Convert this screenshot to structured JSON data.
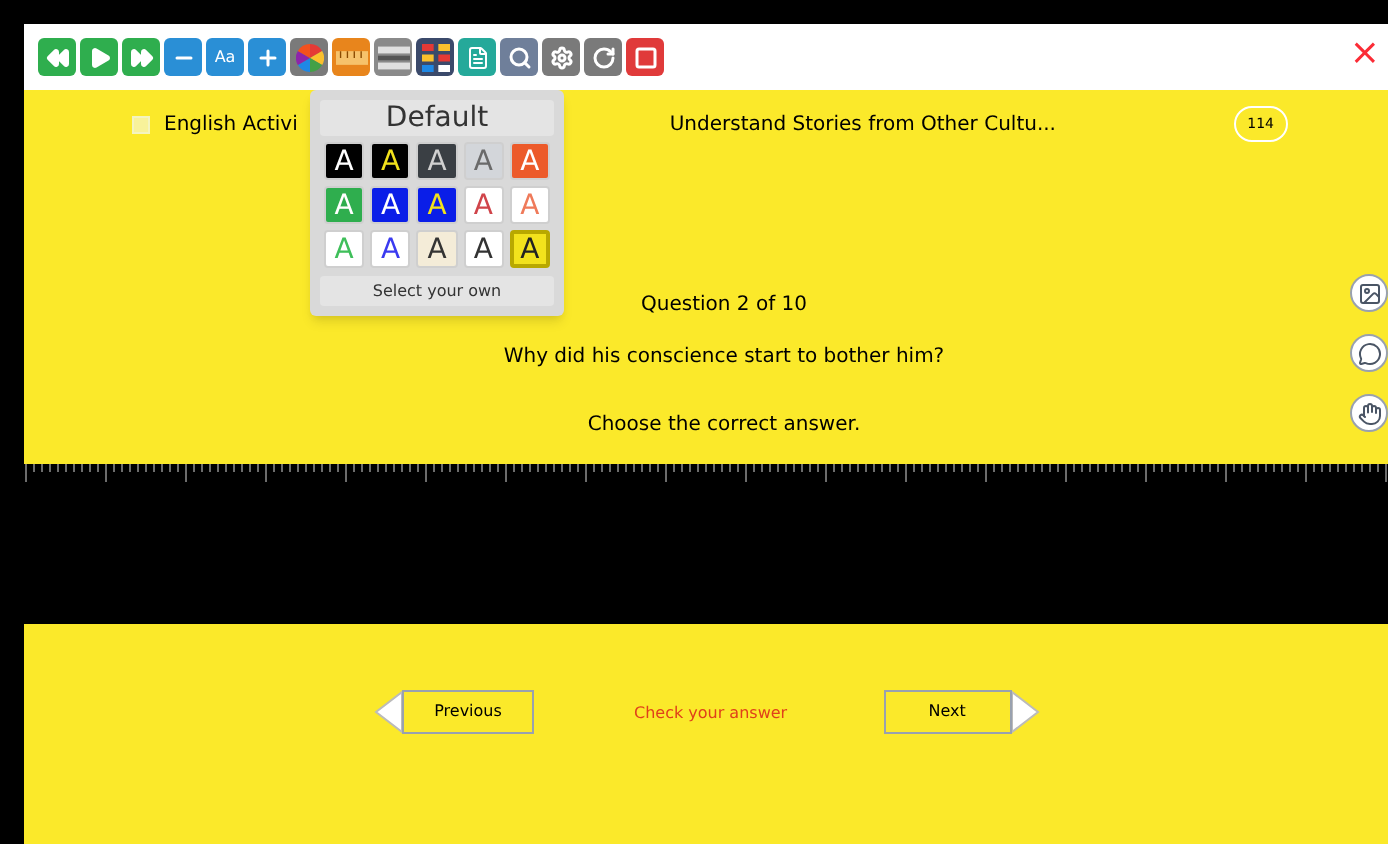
{
  "toolbar": {
    "buttons": [
      {
        "kind": "rewind",
        "color": "#2fae4e"
      },
      {
        "kind": "play",
        "color": "#2fae4e"
      },
      {
        "kind": "forward",
        "color": "#2fae4e"
      },
      {
        "kind": "minus",
        "color": "#2a8fd6"
      },
      {
        "kind": "text",
        "color": "#2a8fd6",
        "label": "Aa"
      },
      {
        "kind": "plus",
        "color": "#2a8fd6"
      },
      {
        "kind": "colors",
        "color": "#7a7a7a"
      },
      {
        "kind": "ruler",
        "color": "#e8851c"
      },
      {
        "kind": "mask",
        "color": "#8a8a8a"
      },
      {
        "kind": "grid",
        "color": "#3b4a6b"
      },
      {
        "kind": "notes",
        "color": "#25a99a"
      },
      {
        "kind": "search",
        "color": "#6f7f9a"
      },
      {
        "kind": "settings",
        "color": "#7a7a7a"
      },
      {
        "kind": "reload",
        "color": "#7a7a7a"
      },
      {
        "kind": "stop",
        "color": "#e03a3a"
      }
    ],
    "close": "×"
  },
  "header": {
    "checked": false,
    "title_left": "English Activi",
    "title_right": "Understand Stories from Other Cultu...",
    "badge": "114"
  },
  "color_popup": {
    "title": "Default",
    "swatches": [
      {
        "color": "#000000",
        "letter": {
          "label": "A",
          "color": "#ffffff"
        },
        "selected": false
      },
      {
        "color": "#000000",
        "letter": {
          "label": "A",
          "color": "#f2e21c"
        },
        "selected": false
      },
      {
        "color": "#3a3f44",
        "letter": {
          "label": "A",
          "color": "#d0d0d0"
        },
        "selected": false
      },
      {
        "color": "#d3d6da",
        "letter": {
          "label": "A",
          "color": "#6a6a6a"
        },
        "selected": false
      },
      {
        "color": "#ec5a2a",
        "letter": {
          "label": "A",
          "color": "#ffffff"
        },
        "selected": false
      },
      {
        "color": "#2fae4e",
        "letter": {
          "label": "A",
          "color": "#ffffff"
        },
        "selected": false
      },
      {
        "color": "#0a1ee8",
        "letter": {
          "label": "A",
          "color": "#ffffff"
        },
        "selected": false
      },
      {
        "color": "#0a1ee8",
        "letter": {
          "label": "A",
          "color": "#f2e21c"
        },
        "selected": false
      },
      {
        "color": "#ffffff",
        "letter": {
          "label": "A",
          "color": "#d0444a"
        },
        "selected": false
      },
      {
        "color": "#ffffff",
        "letter": {
          "label": "A",
          "color": "#ef7a5a"
        },
        "selected": false
      },
      {
        "color": "#ffffff",
        "letter": {
          "label": "A",
          "color": "#3fbf5a"
        },
        "selected": false
      },
      {
        "color": "#ffffff",
        "letter": {
          "label": "A",
          "color": "#3a3af0"
        },
        "selected": false
      },
      {
        "color": "#f4ecd8",
        "letter": {
          "label": "A",
          "color": "#333333"
        },
        "selected": false
      },
      {
        "color": "#ffffff",
        "letter": {
          "label": "A",
          "color": "#333333"
        },
        "selected": false
      },
      {
        "color": "#f2e21c",
        "letter": {
          "label": "A",
          "color": "#222222"
        },
        "selected": true
      }
    ],
    "custom": "Select your own"
  },
  "question": {
    "counter": "Question 2 of 10",
    "text": "Why did his conscience start to bother him?",
    "instruction": "Choose the correct answer."
  },
  "side_tools": [
    {
      "kind": "picture"
    },
    {
      "kind": "speech"
    },
    {
      "kind": "hand"
    }
  ],
  "footer": {
    "previous": "Previous",
    "check": "Check your answer",
    "next": "Next"
  }
}
